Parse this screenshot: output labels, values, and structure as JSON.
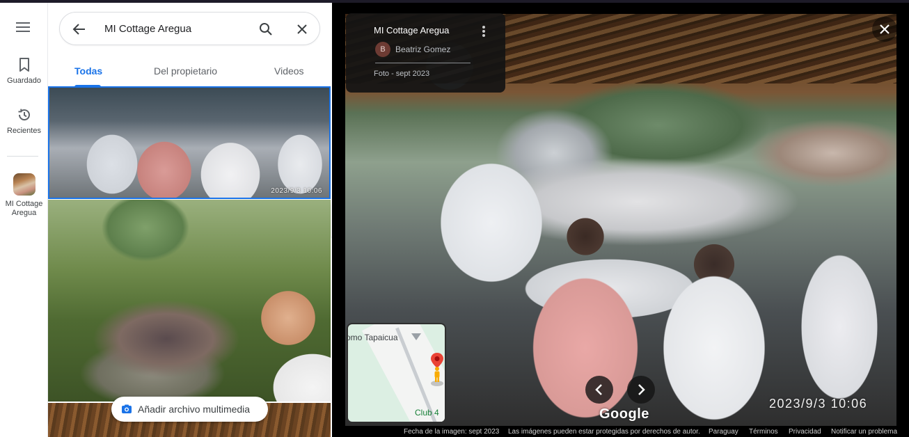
{
  "nav_rail": {
    "saved_label": "Guardado",
    "recents_label": "Recientes",
    "place_label": "MI Cottage Aregua"
  },
  "search": {
    "query": "MI Cottage Aregua"
  },
  "tabs": [
    {
      "label": "Todas",
      "active": true
    },
    {
      "label": "Del propietario",
      "active": false
    },
    {
      "label": "Videos",
      "active": false
    }
  ],
  "gallery": {
    "photo_1_timestamp": "2023/9/3  10:06",
    "add_media_label": "Añadir archivo multimedia"
  },
  "viewer": {
    "title": "MI Cottage Aregua",
    "author_initial": "B",
    "author_name": "Beatriz Gomez",
    "date": "Foto - sept 2023",
    "camera_timestamp": "2023/9/3  10:06",
    "google_label": "Google",
    "minimap": {
      "label_top": "omo Tapaicua",
      "label_bottom": "Club 4"
    }
  },
  "footer": {
    "image_date": "Fecha de la imagen: sept 2023",
    "copyright": "Las imágenes pueden estar protegidas por derechos de autor.",
    "country": "Paraguay",
    "terms": "Términos",
    "privacy": "Privacidad",
    "report": "Notificar un problema"
  },
  "colors": {
    "accent": "#1a73e8",
    "viewer_bg": "#000000",
    "card_bg": "#141414"
  }
}
